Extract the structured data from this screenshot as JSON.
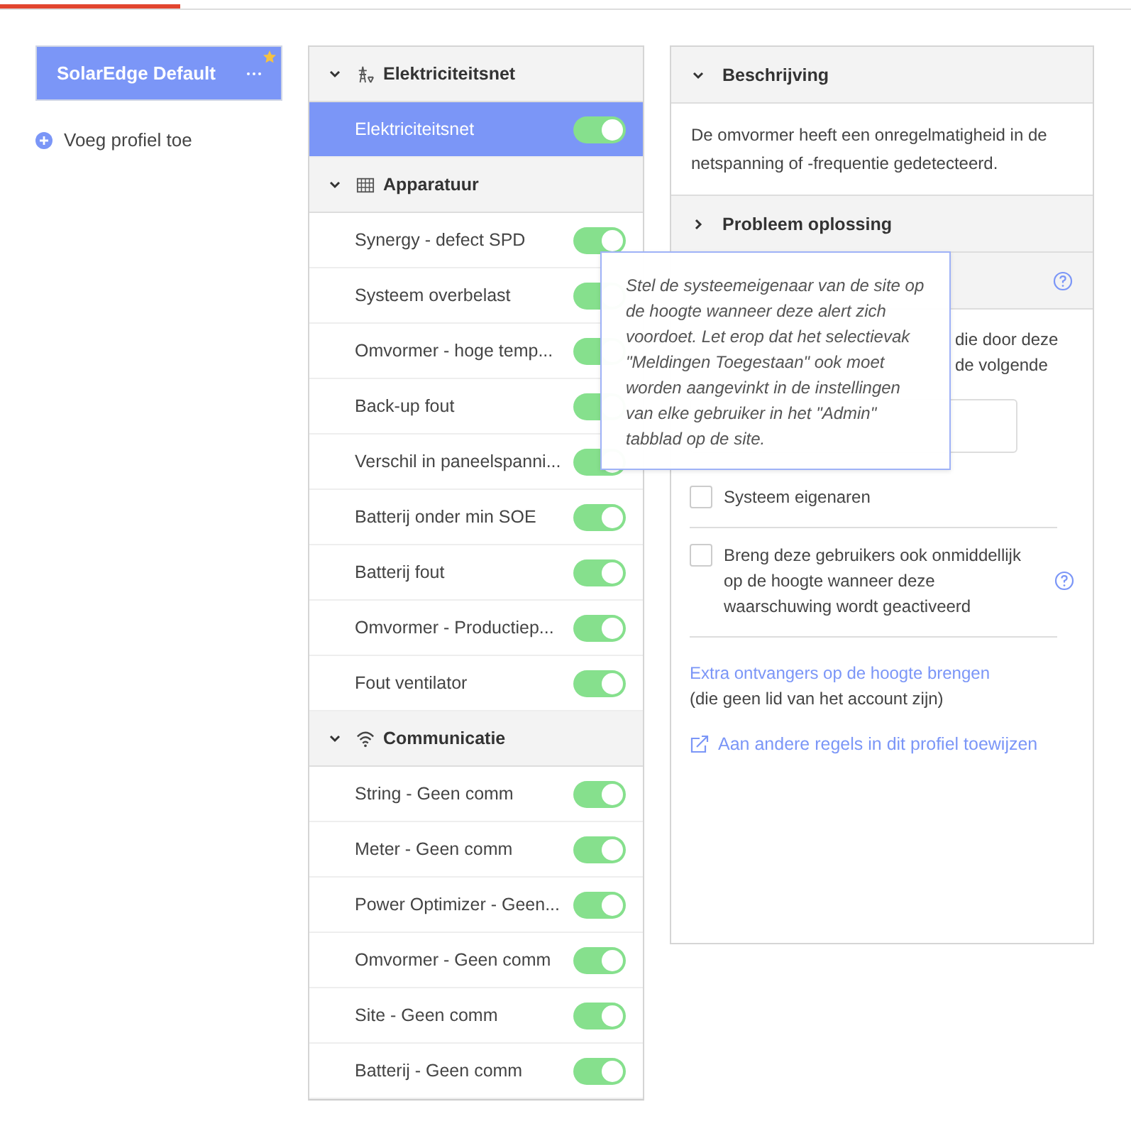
{
  "profiles": [
    {
      "name": "SolarEdge Default",
      "selected": true,
      "favorite": true
    }
  ],
  "add_profile": "Voeg profiel toe",
  "groups": [
    {
      "title": "Elektriciteitsnet",
      "expanded": true,
      "items": [
        {
          "label": "Elektriciteitsnet",
          "on": true,
          "selected": true
        }
      ]
    },
    {
      "title": "Apparatuur",
      "expanded": true,
      "items": [
        {
          "label": "Synergy - defect SPD",
          "on": true,
          "selected": false
        },
        {
          "label": "Systeem overbelast",
          "on": true,
          "selected": false
        },
        {
          "label": "Omvormer - hoge temp...",
          "on": true,
          "selected": false
        },
        {
          "label": "Back-up fout",
          "on": true,
          "selected": false
        },
        {
          "label": "Verschil in paneelspanni...",
          "on": true,
          "selected": false
        },
        {
          "label": "Batterij onder min SOE",
          "on": true,
          "selected": false
        },
        {
          "label": "Batterij fout",
          "on": true,
          "selected": false
        },
        {
          "label": "Omvormer - Productiep...",
          "on": true,
          "selected": false
        },
        {
          "label": "Fout ventilator",
          "on": true,
          "selected": false
        }
      ]
    },
    {
      "title": "Communicatie",
      "expanded": true,
      "items": [
        {
          "label": "String - Geen comm",
          "on": true,
          "selected": false
        },
        {
          "label": "Meter - Geen comm",
          "on": true,
          "selected": false
        },
        {
          "label": "Power Optimizer - Geen...",
          "on": true,
          "selected": false
        },
        {
          "label": "Omvormer - Geen comm",
          "on": true,
          "selected": false
        },
        {
          "label": "Site - Geen comm",
          "on": true,
          "selected": false
        },
        {
          "label": "Batterij - Geen comm",
          "on": true,
          "selected": false
        }
      ]
    }
  ],
  "description": {
    "title": "Beschrijving",
    "expanded": true,
    "text": "De omvormer heeft een onregelmatigheid in de netspanning of -frequentie gedetecteerd."
  },
  "troubleshooting": {
    "title": "Probleem oplossing",
    "expanded": false
  },
  "notifications": {
    "expanded": true,
    "intro_fragments": [
      "die door deze",
      "de volgende"
    ],
    "owners": {
      "label": "Systeem eigenaren",
      "checked": false
    },
    "escalate": {
      "label": "Breng deze gebruikers ook onmiddellijk op de hoogte wanneer deze waarschuwing wordt geactiveerd",
      "checked": false
    },
    "extra_link": "Extra ontvangers op de hoogte brengen",
    "extra_note": "(die geen lid van het account zijn)",
    "assign_link": "Aan andere regels in dit profiel toewijzen"
  },
  "tooltip": {
    "text": "Stel de systeemeigenaar van de site op de hoogte wanneer deze alert zich voordoet. Let erop dat het selectievak \"Meldingen Toegestaan\" ook moet worden aangevinkt in de instellingen van elke gebruiker in het \"Admin\" tabblad op de site."
  }
}
